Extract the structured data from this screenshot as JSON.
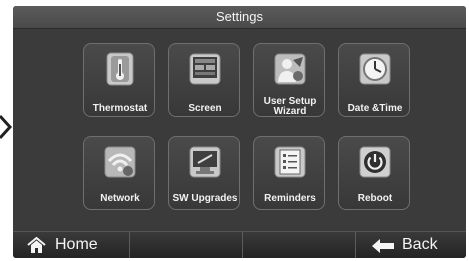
{
  "window": {
    "title": "Settings"
  },
  "tiles": [
    {
      "label": "Thermostat",
      "icon": "thermostat-icon"
    },
    {
      "label": "Screen",
      "icon": "screen-icon"
    },
    {
      "label_line1": "User Setup",
      "label_line2": "Wizard",
      "icon": "user-setup-wizard-icon"
    },
    {
      "label": "Date &Time",
      "icon": "clock-icon"
    },
    {
      "label": "Network",
      "icon": "network-icon"
    },
    {
      "label": "SW Upgrades",
      "icon": "sw-upgrades-icon"
    },
    {
      "label": "Reminders",
      "icon": "reminders-icon"
    },
    {
      "label": "Reboot",
      "icon": "power-icon"
    }
  ],
  "bottom_bar": {
    "home_label": "Home",
    "back_label": "Back"
  },
  "colors": {
    "screen_bg": "#3b3b3b",
    "tile_border": "#6f6f6f",
    "text": "#f2f2f2"
  }
}
